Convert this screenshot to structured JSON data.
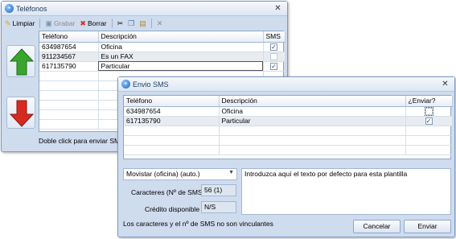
{
  "telefonos": {
    "title": "Teléfonos",
    "toolbar": {
      "clear_label": "Limpiar",
      "save_label": "Grabar",
      "delete_label": "Borrar"
    },
    "columns": [
      "Teléfono",
      "Descripción",
      "SMS"
    ],
    "rows": [
      {
        "phone": "634987654",
        "description": "Oficina",
        "sms": true
      },
      {
        "phone": "911234567",
        "description": "Es un FAX",
        "sms": false
      },
      {
        "phone": "617135790",
        "description": "Particular",
        "sms": true
      }
    ],
    "hint": "Doble click para enviar SMS",
    "colors": {
      "up_arrow": "#3aa52e",
      "down_arrow": "#d62a21"
    },
    "icons": {
      "up": "green-up-arrow",
      "down": "red-down-arrow"
    }
  },
  "envio_sms": {
    "title": "Envio SMS",
    "columns": [
      "Teléfono",
      "Descripción",
      "¿Enviar?"
    ],
    "rows": [
      {
        "phone": "634987654",
        "description": "Oficina",
        "send": false
      },
      {
        "phone": "617135790",
        "description": "Particular",
        "send": true
      }
    ],
    "template_select": "Movistar (oficina) (auto.)",
    "message_placeholder": "Introduzca aquí el texto por defecto para esta plantilla",
    "chars_label": "Caracteres (Nº de SMS)",
    "chars_value": "56 (1)",
    "credit_label": "Crédito disponible",
    "credit_value": "N/S",
    "disclaimer": "Los caracteres y el nº de SMS no son vinculantes",
    "cancel_label": "Cancelar",
    "send_label": "Enviar"
  }
}
